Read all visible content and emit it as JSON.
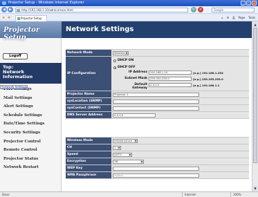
{
  "browser": {
    "title": "Projector Setup - Windows Internet Explorer",
    "url": "http://192.168.1.10/admin/main.html",
    "search_placeholder": "Google",
    "tab_title": "Projector Setup",
    "tools": [
      "Page",
      "Tools"
    ],
    "status_text": "Done",
    "zone": "Internet",
    "zoom": "100%"
  },
  "sidebar": {
    "banner": "Projector Setup",
    "logoff": "Logoff",
    "top_line1": "Top:",
    "top_line2": "Network",
    "top_line3": "Information",
    "items": [
      {
        "label": "Network Settings",
        "selected": true
      },
      {
        "label": "Port Settings"
      },
      {
        "label": "Mail Settings"
      },
      {
        "label": "Alert Settings"
      },
      {
        "label": "Schedule Settings"
      },
      {
        "label": "Date/Time Settings"
      },
      {
        "label": "Security Settings"
      },
      {
        "label": "Projector Control"
      },
      {
        "label": "Remote Control"
      },
      {
        "label": "Projector Status"
      },
      {
        "label": "Network Restart"
      }
    ]
  },
  "main": {
    "title": "Network Settings",
    "network_mode": {
      "label": "Network Mode",
      "value": "Wireless"
    },
    "ip": {
      "label": "IP Configuration",
      "dhcp_on": "DHCP ON",
      "dhcp_off": "DHCP OFF",
      "ip_label": "IP Address",
      "ip_value": "192.168.1.10",
      "ip_hint": "[e.g.] 192.168.1.254",
      "mask_label": "Subnet Mask",
      "mask_value": "255.255.255.0",
      "mask_hint": "[e.g.] 255.255.255.0",
      "gw_label": "Default Gateway",
      "gw_value": "0.0.0.0",
      "gw_hint": "[e.g.] 192.168.1.1"
    },
    "projector_name": {
      "label": "Projector Name",
      "value": "Projector 1"
    },
    "sys_location": {
      "label": "sysLocation (SNMP)",
      "value": ""
    },
    "sys_contact": {
      "label": "sysContact (SNMP)",
      "value": ""
    },
    "dns": {
      "label": "DNS Server Address",
      "value": "0.0.0.0"
    },
    "wireless_mode": {
      "label": "Wireless Mode",
      "value": "Infrastructure"
    },
    "ch": {
      "label": "CH",
      "value": "1"
    },
    "speed": {
      "label": "Speed",
      "value": "AUTO"
    },
    "encryption": {
      "label": "Encryption",
      "value": "Off"
    },
    "wep": {
      "label": "WEP Key",
      "value": ""
    },
    "wpa": {
      "label": "WPA Passphrase",
      "value": "hidden"
    }
  }
}
